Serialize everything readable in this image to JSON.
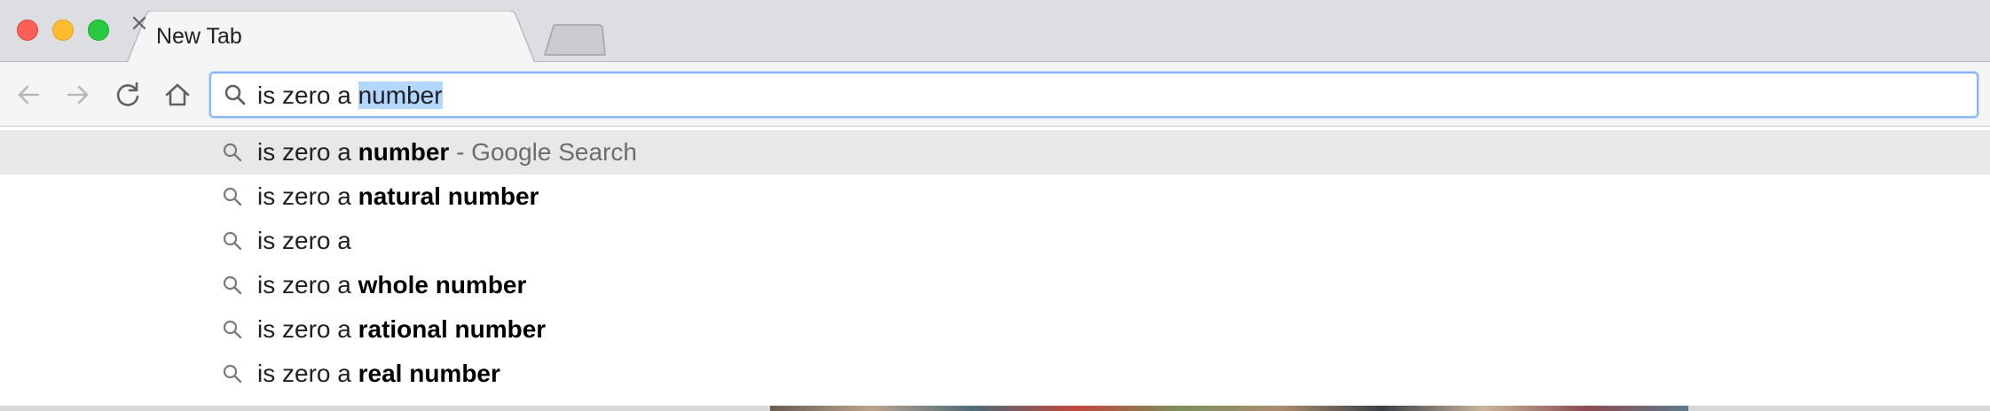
{
  "window": {
    "controls": [
      "close",
      "minimize",
      "maximize"
    ]
  },
  "tab": {
    "title": "New Tab",
    "close_icon": "close-icon"
  },
  "new_tab_icon": "new-tab-icon",
  "toolbar": {
    "back_icon": "arrow-left-icon",
    "forward_icon": "arrow-right-icon",
    "reload_icon": "reload-icon",
    "home_icon": "home-icon"
  },
  "omnibox": {
    "typed": "is zero a ",
    "autocomplete_selected": "number",
    "search_icon": "search-icon"
  },
  "suggestions": [
    {
      "prefix": "is zero a ",
      "bold": "number",
      "description": " - Google Search",
      "highlighted": true
    },
    {
      "prefix": "is zero a ",
      "bold": "natural number",
      "description": "",
      "highlighted": false
    },
    {
      "prefix": "is zero a",
      "bold": "",
      "description": "",
      "highlighted": false
    },
    {
      "prefix": "is zero a ",
      "bold": "whole number",
      "description": "",
      "highlighted": false
    },
    {
      "prefix": "is zero a ",
      "bold": "rational number",
      "description": "",
      "highlighted": false
    },
    {
      "prefix": "is zero a ",
      "bold": "real number",
      "description": "",
      "highlighted": false
    }
  ],
  "colors": {
    "titlebar": "#dcdee1",
    "toolbar": "#f5f5f5",
    "omnibox_focus": "#8ab4f8",
    "selection": "#b3d7fe",
    "highlight_row": "#e8e8e8"
  }
}
